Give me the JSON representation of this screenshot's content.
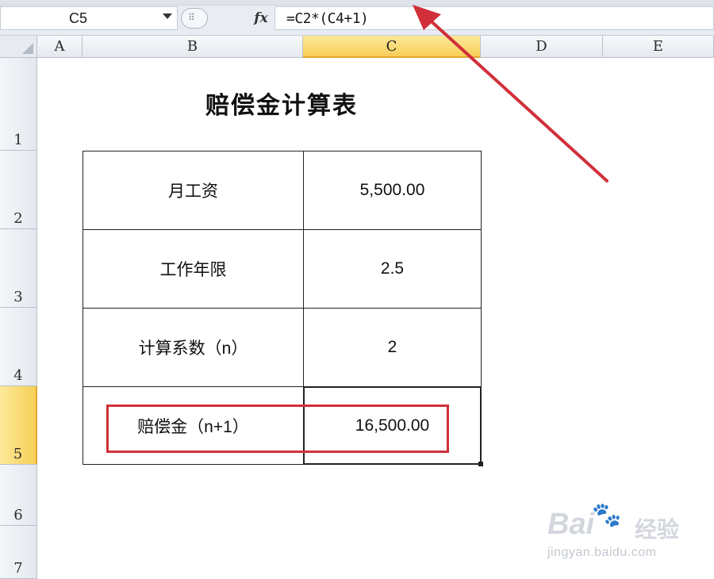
{
  "formula_bar": {
    "name_box": "C5",
    "fx_label": "fx",
    "formula": "=C2*(C4+1)"
  },
  "columns": [
    "A",
    "B",
    "C",
    "D",
    "E"
  ],
  "active_column": "C",
  "rows": [
    "1",
    "2",
    "3",
    "4",
    "5",
    "6",
    "7"
  ],
  "active_row": "5",
  "sheet": {
    "title": "赔偿金计算表",
    "table": [
      {
        "label": "月工资",
        "value": "5,500.00"
      },
      {
        "label": "工作年限",
        "value": "2.5"
      },
      {
        "label": "计算系数（n）",
        "value": "2"
      },
      {
        "label": "赔偿金（n+1）",
        "value": "16,500.00"
      }
    ]
  },
  "annotation": {
    "color": "#d1303a"
  },
  "watermark": {
    "logo": "Bai",
    "brand": "经验",
    "url": "jingyan.baidu.com"
  }
}
